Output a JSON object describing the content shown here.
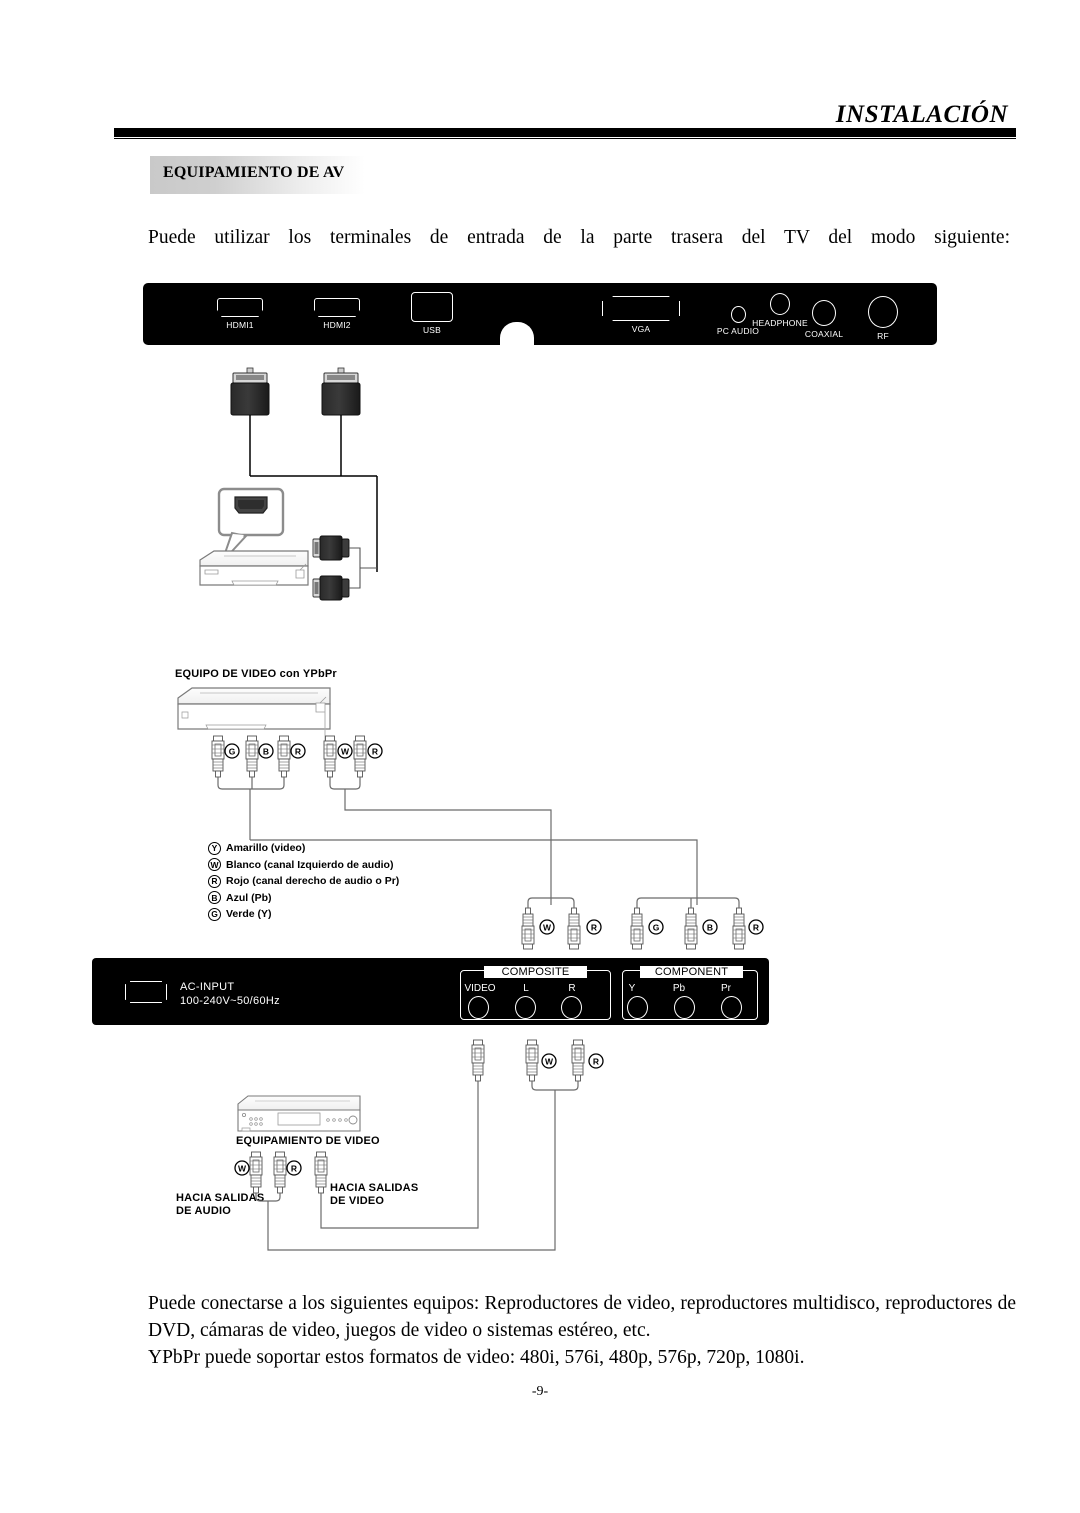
{
  "header": {
    "title": "INSTALACIÓN"
  },
  "section": {
    "badge_label": "EQUIPAMIENTO DE AV"
  },
  "intro": {
    "text": "Puede utilizar los terminales de entrada de la parte trasera del TV del modo siguiente:"
  },
  "port_panel": {
    "ports": [
      {
        "name": "hdmi1",
        "label": "HDMI1",
        "icon": "hdmi-port-icon"
      },
      {
        "name": "hdmi2",
        "label": "HDMI2",
        "icon": "hdmi-port-icon"
      },
      {
        "name": "usb",
        "label": "USB",
        "icon": "usb-port-icon"
      },
      {
        "name": "vga",
        "label": "VGA",
        "icon": "vga-port-icon"
      },
      {
        "name": "pc-audio",
        "label": "PC AUDIO",
        "icon": "audio-jack-icon"
      },
      {
        "name": "headphone",
        "label": "HEADPHONE",
        "icon": "headphone-jack-icon"
      },
      {
        "name": "coaxial",
        "label": "COAXIAL",
        "icon": "coaxial-jack-icon"
      },
      {
        "name": "rf",
        "label": "RF",
        "icon": "rf-jack-icon"
      }
    ]
  },
  "hdmi_diagram": {
    "callout_label": "HDMI"
  },
  "ypbpr_diagram": {
    "title": "EQUIPO DE VIDEO con YPbPr",
    "source_plugs": [
      "G",
      "B",
      "R"
    ],
    "source_audio_plugs": [
      "W",
      "R"
    ],
    "tv_audio_plugs": [
      "W",
      "R"
    ],
    "tv_component_plugs": [
      "G",
      "B",
      "R"
    ]
  },
  "legend": {
    "items": [
      {
        "badge": "Y",
        "text": "Amarillo (video)"
      },
      {
        "badge": "W",
        "text": "Blanco (canal Izquierdo de audio)"
      },
      {
        "badge": "R",
        "text": "Rojo (canal derecho de audio o Pr)"
      },
      {
        "badge": "B",
        "text": "Azul (Pb)"
      },
      {
        "badge": "G",
        "text": "Verde (Y)"
      }
    ]
  },
  "rear_panel": {
    "ac_input_label": "AC-INPUT",
    "ac_input_spec": "100-240V~50/60Hz",
    "composite": {
      "title": "COMPOSITE",
      "jacks": [
        "VIDEO",
        "L",
        "R"
      ]
    },
    "component": {
      "title": "COMPONENT",
      "jacks": [
        "Y",
        "Pb",
        "Pr"
      ]
    }
  },
  "video_equipment": {
    "title": "EQUIPAMIENTO DE VIDEO",
    "audio_plugs": [
      "W",
      "R"
    ],
    "audio_out_label": "HACIA SALIDAS\nDE AUDIO",
    "video_out_label": "HACIA SALIDAS\nDE VIDEO"
  },
  "outro": {
    "line1": "Puede conectarse a los siguientes equipos: Reproductores de video, reproductores multidisco, reproductores de DVD, cámaras de video, juegos de video o sistemas estéreo, etc.",
    "line2": "YPbPr puede soportar estos formatos de video: 480i, 576i, 480p, 576p, 720p, 1080i."
  },
  "footer": {
    "page_number": "-9-"
  }
}
